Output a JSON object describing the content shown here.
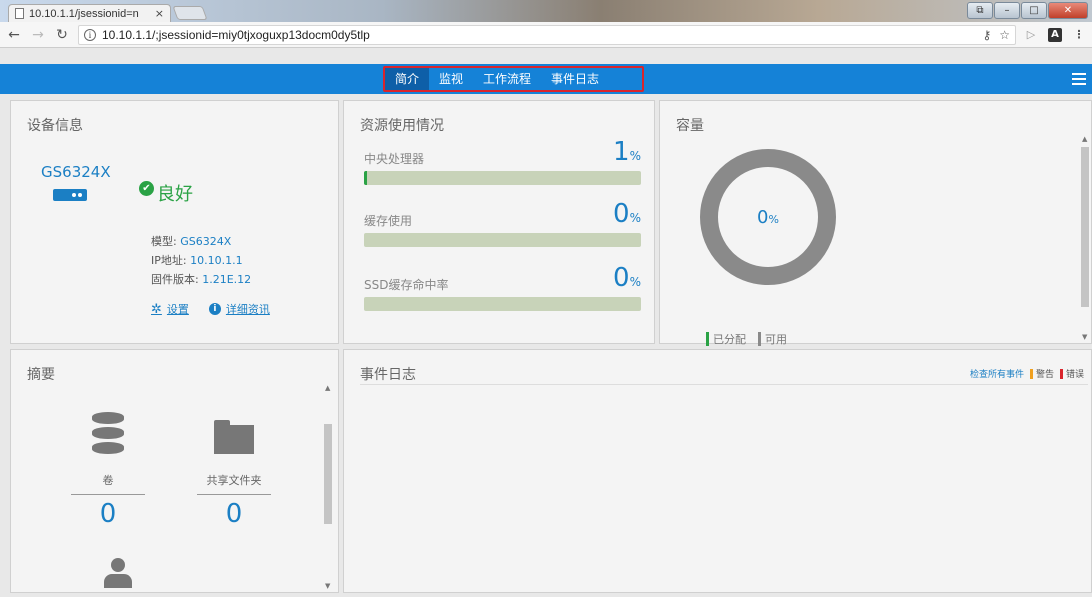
{
  "browser": {
    "tab_title": "10.10.1.1/jsessionid=n",
    "tab_close": "×",
    "url": "10.10.1.1/;jsessionid=miy0tjxoguxp13docm0dy5tlp",
    "icons": [
      "back-icon",
      "forward-icon",
      "reload-icon",
      "info-icon",
      "key-icon",
      "star-icon",
      "play-icon",
      "pdf-icon",
      "menu-icon"
    ]
  },
  "nav": {
    "items": [
      {
        "label": "简介",
        "active": true
      },
      {
        "label": "监视",
        "active": false
      },
      {
        "label": "工作流程",
        "active": false
      },
      {
        "label": "事件日志",
        "active": false
      }
    ]
  },
  "device": {
    "title": "设备信息",
    "model_name": "GS6324X",
    "status": "良好",
    "model_label": "模型: ",
    "model_value": "GS6324X",
    "ip_label": "IP地址: ",
    "ip_value": "10.10.1.1",
    "fw_label": "固件版本: ",
    "fw_value": "1.21E.12",
    "settings_link": "设置",
    "details_link": "详细资讯"
  },
  "resource": {
    "title": "资源使用情况",
    "rows": [
      {
        "label": "中央处理器",
        "value": "1",
        "unit": "%",
        "fill": 0.01
      },
      {
        "label": "缓存使用",
        "value": "0",
        "unit": "%",
        "fill": 0
      },
      {
        "label": "SSD缓存命中率",
        "value": "0",
        "unit": "%",
        "fill": 0
      }
    ]
  },
  "capacity": {
    "title": "容量",
    "value": "0",
    "unit": "%",
    "legend": [
      {
        "label": "已分配",
        "color": "#2aa245"
      },
      {
        "label": "可用",
        "color": "#8a8a8a"
      }
    ]
  },
  "summary": {
    "title": "摘要",
    "volumes_label": "卷",
    "volumes_count": "0",
    "shares_label": "共享文件夹",
    "shares_count": "0"
  },
  "events": {
    "title": "事件日志",
    "view_all": "检查所有事件",
    "warning_label": "警告",
    "warning_color": "#f0a020",
    "error_label": "错误",
    "error_color": "#d9242c"
  },
  "colors": {
    "nav_bg": "#1582d7",
    "accent": "#1b7fc4",
    "ok": "#2aa245",
    "highlight_border": "#d9242c"
  }
}
